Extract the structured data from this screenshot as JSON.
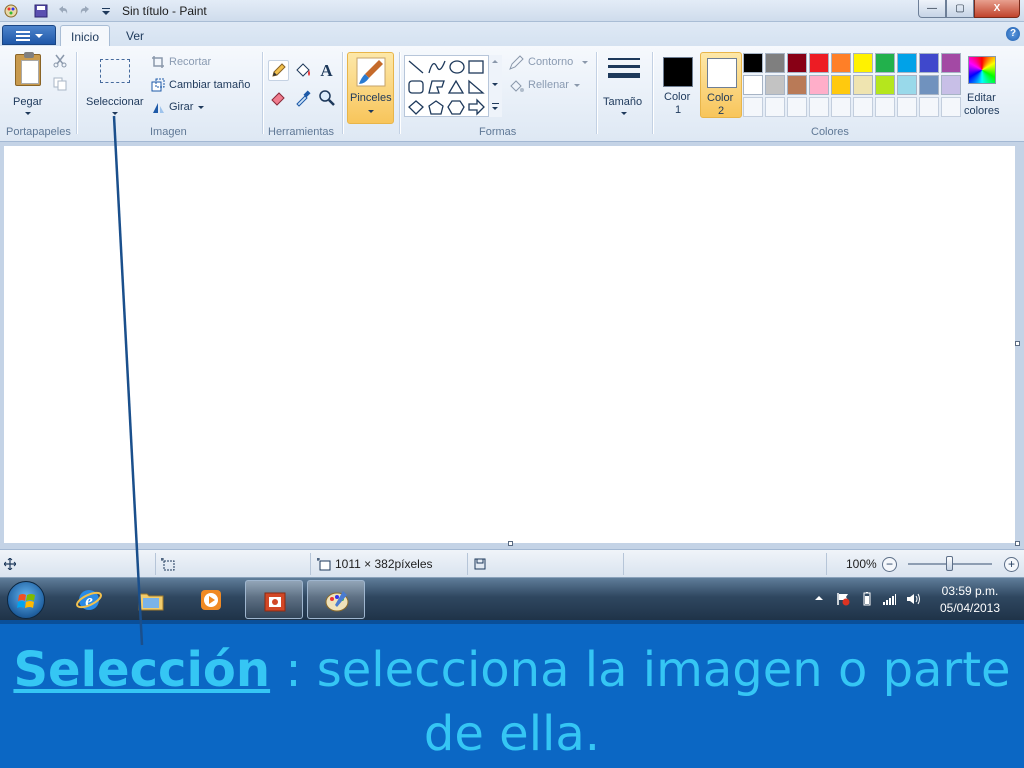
{
  "window": {
    "title": "Sin título - Paint",
    "controls": {
      "minimize": "—",
      "maximize": "▢",
      "close": "X"
    }
  },
  "tabs": [
    {
      "label": "Inicio",
      "active": true
    },
    {
      "label": "Ver",
      "active": false
    }
  ],
  "ribbon": {
    "clipboard": {
      "paste_label": "Pegar",
      "group_label": "Portapapeles"
    },
    "image": {
      "select_label": "Seleccionar",
      "crop_label": "Recortar",
      "resize_label": "Cambiar tamaño",
      "rotate_label": "Girar",
      "group_label": "Imagen"
    },
    "tools": {
      "group_label": "Herramientas",
      "text_tool_glyph": "A"
    },
    "brushes": {
      "label": "Pinceles"
    },
    "shapes": {
      "outline_label": "Contorno",
      "fill_label": "Rellenar",
      "group_label": "Formas"
    },
    "size": {
      "label": "Tamaño"
    },
    "colors": {
      "color1_label": "Color",
      "color1_num": "1",
      "color2_label": "Color",
      "color2_num": "2",
      "color1_value": "#000000",
      "color2_value": "#ffffff",
      "edit_label_line1": "Editar",
      "edit_label_line2": "colores",
      "group_label": "Colores",
      "palette_row1": [
        "#000000",
        "#7f7f7f",
        "#880015",
        "#ed1c24",
        "#ff7f27",
        "#fff200",
        "#22b14c",
        "#00a2e8",
        "#3f48cc",
        "#a349a4"
      ],
      "palette_row2": [
        "#ffffff",
        "#c3c3c3",
        "#b97a57",
        "#ffaec9",
        "#ffc90e",
        "#efe4b0",
        "#b5e61d",
        "#99d9ea",
        "#7092be",
        "#c8bfe7"
      ]
    }
  },
  "statusbar": {
    "dimensions": "1011 × 382píxeles",
    "zoom": "100%"
  },
  "taskbar": {
    "time": "03:59 p.m.",
    "date": "05/04/2013"
  },
  "caption": {
    "term": "Selección",
    "line1_rest": " : selecciona la imagen o parte",
    "line2": "de ella."
  }
}
